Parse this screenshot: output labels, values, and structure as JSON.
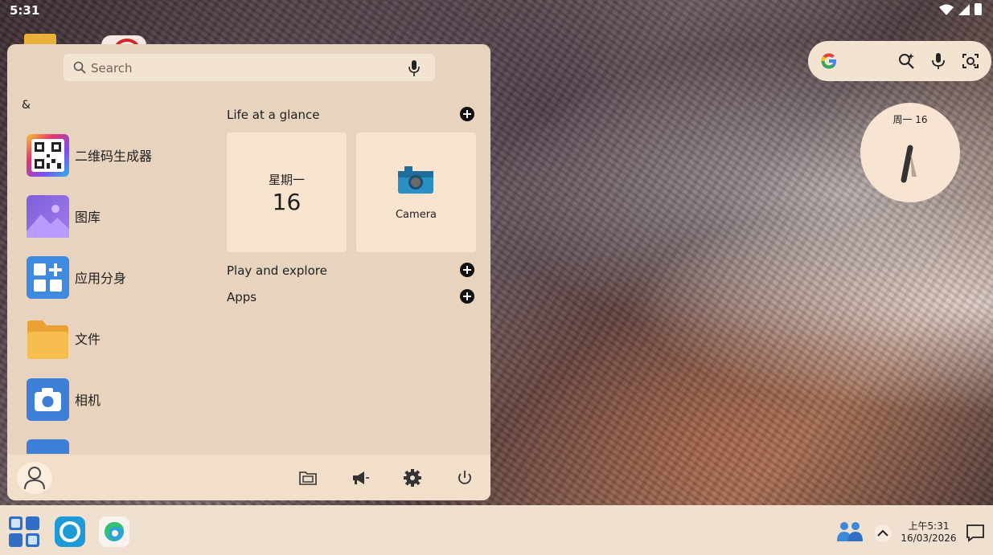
{
  "status_bar": {
    "time": "5:31"
  },
  "start_menu": {
    "search": {
      "placeholder": "Search"
    },
    "letter_header": "&",
    "apps": [
      {
        "label": "二维码生成器",
        "icon": "qr-code-icon"
      },
      {
        "label": "图库",
        "icon": "gallery-icon"
      },
      {
        "label": "应用分身",
        "icon": "app-clone-icon"
      },
      {
        "label": "文件",
        "icon": "folder-icon"
      },
      {
        "label": "相机",
        "icon": "camera-icon"
      }
    ],
    "sections": {
      "life": "Life at a glance",
      "play": "Play and explore",
      "apps": "Apps"
    },
    "tiles": {
      "calendar": {
        "weekday": "星期一",
        "day": "16"
      },
      "camera": {
        "label": "Camera"
      }
    }
  },
  "clock_widget": {
    "date": "周一 16"
  },
  "taskbar": {
    "time": "上午5:31",
    "date": "16/03/2026"
  },
  "colors": {
    "panel_bg": "#e8d3bf",
    "tile_bg": "#f9e4cf",
    "taskbar_bg": "#efe0cf"
  }
}
